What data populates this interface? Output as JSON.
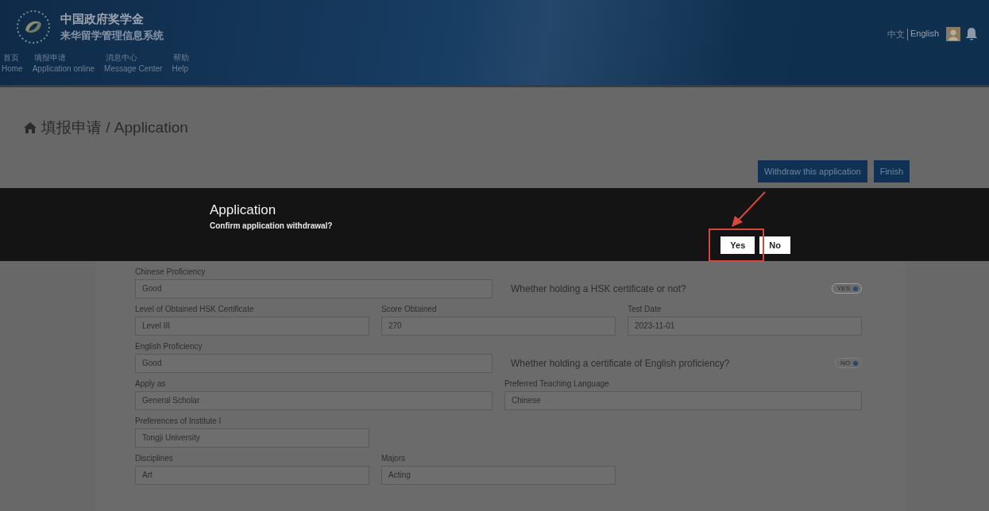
{
  "header": {
    "title_lines": [
      "中国政府奖学金",
      "来华留学管理信息系统"
    ],
    "nav": [
      {
        "zh": "首页",
        "en": "Home"
      },
      {
        "zh": "填报申请",
        "en": "Application online"
      },
      {
        "zh": "消息中心",
        "en": "Message Center"
      },
      {
        "zh": "帮助",
        "en": "Help"
      }
    ],
    "languages": [
      {
        "label": "中文",
        "selected": false
      },
      {
        "label": "English",
        "selected": true
      }
    ]
  },
  "breadcrumb": "填报申请 / Application",
  "actions": [
    "Withdraw this application",
    "Finish"
  ],
  "dialog": {
    "title": "Application",
    "message": "Confirm application withdrawal?",
    "buttons": [
      "Yes",
      "No"
    ]
  },
  "form": {
    "rows": [
      {
        "items": [
          {
            "kind": "wide_field",
            "label": "Chinese Proficiency",
            "value": "Good"
          },
          {
            "kind": "toggle",
            "question": "Whether holding a HSK certificate or not?",
            "label": "YES",
            "on": true
          }
        ]
      },
      {
        "items": [
          {
            "kind": "narrow_field",
            "label": "Level of Obtained HSK Certificate",
            "value": "Level III"
          },
          {
            "kind": "narrow_field",
            "label": "Score Obtained",
            "value": "270"
          },
          {
            "kind": "narrow_field",
            "label": "Test Date",
            "value": "2023-11-01"
          }
        ]
      },
      {
        "items": [
          {
            "kind": "wide_field",
            "label": "English Proficiency",
            "value": "Good"
          },
          {
            "kind": "toggle",
            "question": "Whether holding a certificate of English proficiency?",
            "label": "NO",
            "on": false
          }
        ]
      },
      {
        "items": [
          {
            "kind": "wide_field",
            "label": "Apply as",
            "value": "General Scholar"
          },
          {
            "kind": "wide_field",
            "label": "Preferred Teaching Language",
            "value": "Chinese"
          }
        ]
      },
      {
        "items": [
          {
            "kind": "narrow_field",
            "label": "Preferences of Institute I",
            "value": "Tongji University"
          }
        ]
      },
      {
        "items": [
          {
            "kind": "narrow_field",
            "label": "Disciplines",
            "value": "Art"
          },
          {
            "kind": "narrow_field",
            "label": "Majors",
            "value": "Acting"
          }
        ]
      }
    ]
  }
}
